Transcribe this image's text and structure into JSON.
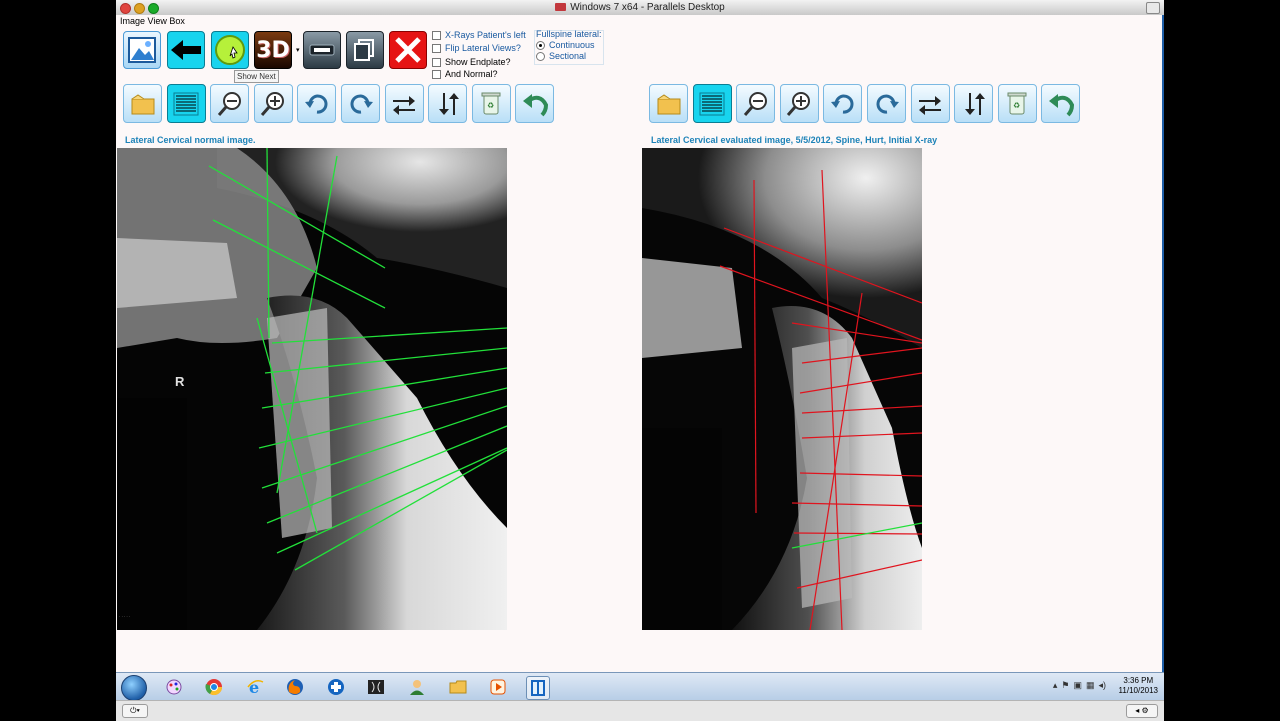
{
  "mac": {
    "window_title": "Windows 7 x64 - Parallels Desktop"
  },
  "app": {
    "title": "Image View Box",
    "tooltip": "Show Next",
    "three_d_label": "3D",
    "options": {
      "xrays_patients_left": "X-Rays Patient's left",
      "flip_lateral_views": "Flip Lateral Views?",
      "show_endplate": "Show Endplate?",
      "and_normal": "And Normal?"
    },
    "fullspine": {
      "label": "Fullspine lateral:",
      "continuous": "Continuous",
      "sectional": "Sectional",
      "selected": "Continuous"
    },
    "left_caption": "Lateral Cervical normal image.",
    "right_caption": "Lateral Cervical evaluated image, 5/5/2012, Spine, Hurt, Initial X-ray",
    "xray_marker": "R"
  },
  "colors": {
    "analysis_green": "#22e03a",
    "analysis_red": "#e0141e",
    "toolbar_blue": "#4b9ad6",
    "active_cyan": "#18d4ee",
    "caption_blue": "#1e83b8"
  },
  "taskbar": {
    "time": "3:36 PM",
    "date": "11/10/2013",
    "apps": [
      "paint-icon",
      "chrome-icon",
      "ie-icon",
      "firefox-icon",
      "medical-icon",
      "xray-app-icon",
      "user-icon",
      "folder-icon",
      "media-icon",
      "spine-app-icon"
    ]
  }
}
